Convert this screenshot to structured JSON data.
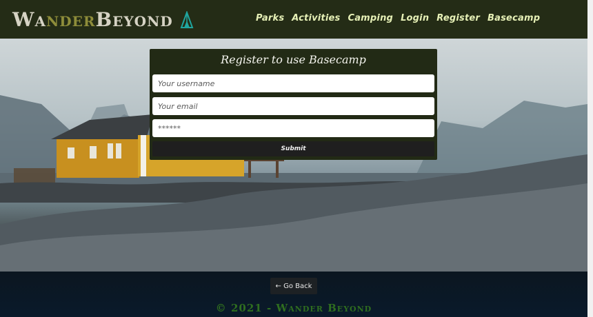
{
  "navbar": {
    "brand": {
      "part1": "Wa",
      "part2": "nder",
      "part3": " Beyond",
      "icon": "tent-icon"
    },
    "links": [
      "Parks",
      "Activities",
      "Camping",
      "Login",
      "Register",
      "Basecamp"
    ]
  },
  "form": {
    "title": "Register to use Basecamp",
    "username_placeholder": "Your username",
    "email_placeholder": "Your email",
    "password_placeholder": "******",
    "submit_label": "Submit"
  },
  "footer": {
    "go_back_label": "← Go Back",
    "copyright": "© 2021 - Wander Beyond"
  },
  "colors": {
    "navbar": "#242c16",
    "nav_link": "#e6f0b6",
    "form_panel": "#222a15",
    "footer": "#0a1a2b",
    "copyright": "#2f6e1f",
    "tent_icon": "#1fa6a0"
  }
}
